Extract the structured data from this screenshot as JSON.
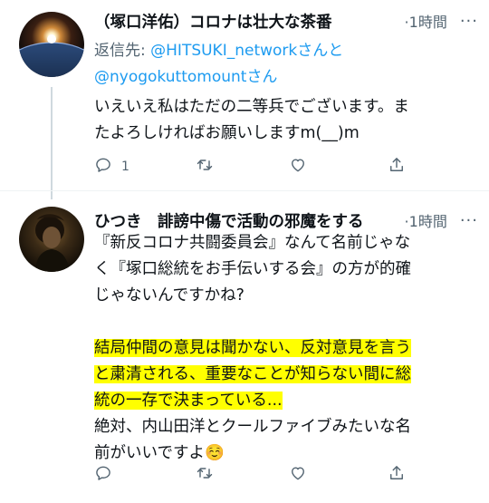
{
  "tweets": [
    {
      "name": "（塚口洋佑）コロナは壮大な茶番",
      "time": "1時間",
      "reply_to": {
        "prefix": "返信先: ",
        "handle1": "@HITSUKI_network",
        "joiner": "さんと",
        "handle2": "@nyogokuttomount",
        "suffix": "さん"
      },
      "text_lines": [
        "いえいえ私はただの二等兵でございます。ま",
        "たよろしければお願いしますm(__)m"
      ],
      "actions": {
        "reply_count": "1",
        "retweet_count": "",
        "like_count": ""
      }
    },
    {
      "name": "ひつき　誹謗中傷で活動の邪魔をする",
      "time": "1時間",
      "text_lines": [
        "『新反コロナ共闘委員会』なんて名前じゃな",
        "く『塚口総統をお手伝いする会』の方が的確",
        "じゃないんですかね?"
      ],
      "highlight_lines": [
        "結局仲間の意見は聞かない、反対意見を言う",
        "と粛清される、重要なことが知らない間に総",
        "統の一存で決まっている..."
      ],
      "tail_lines": [
        "絶対、内山田洋とクールファイブみたいな名",
        "前がいいですよ☺️"
      ],
      "actions": {
        "reply_count": "",
        "retweet_count": "",
        "like_count": ""
      }
    }
  ],
  "ui": {
    "separator": "·",
    "more": "···"
  },
  "icons": [
    "reply-icon",
    "retweet-icon",
    "like-icon",
    "share-icon",
    "more-icon"
  ],
  "colors": {
    "text": "#0f1419",
    "secondary": "#536471",
    "link": "#1d9bf0",
    "highlight": "#ffff00"
  }
}
